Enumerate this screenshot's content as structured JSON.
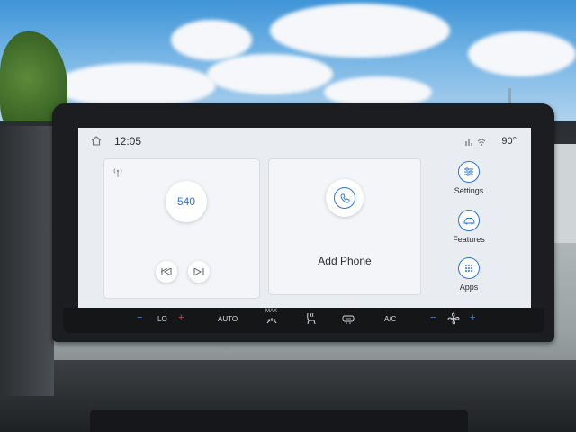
{
  "status_bar": {
    "time": "12:05",
    "temperature": "90°",
    "icons": [
      "home-icon",
      "signal-icon",
      "network-icon"
    ]
  },
  "radio": {
    "frequency": "540",
    "icons": [
      "antenna-icon",
      "seek-back-icon",
      "seek-forward-icon"
    ]
  },
  "phone": {
    "label": "Add Phone",
    "icon": "phone-icon"
  },
  "side_menu": {
    "items": [
      {
        "label": "Settings",
        "icon": "sliders-icon"
      },
      {
        "label": "Features",
        "icon": "car-icon"
      },
      {
        "label": "Apps",
        "icon": "grid-icon"
      }
    ]
  },
  "climate_bar": {
    "temp_minus": "−",
    "temp_value": "LO",
    "temp_plus": "+",
    "auto_label": "AUTO",
    "max_label": "MAX",
    "ac_label": "A/C",
    "fan_minus": "−",
    "fan_plus": "+"
  },
  "colors": {
    "accent": "#2b74d8",
    "screen_bg": "#e9edf1",
    "bezel": "#1b1d20"
  }
}
